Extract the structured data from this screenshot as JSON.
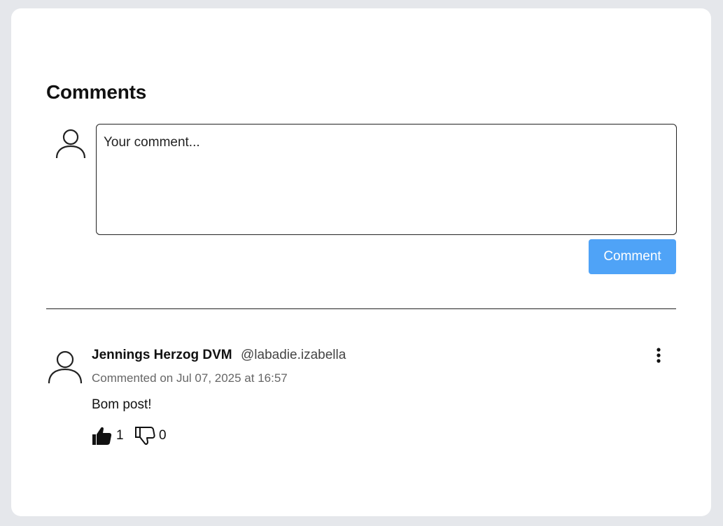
{
  "comments_section": {
    "title": "Comments",
    "composer": {
      "placeholder": "Your comment...",
      "value": "",
      "submit_label": "Comment",
      "submit_color": "#4fa3f7"
    },
    "comments": [
      {
        "author_name": "Jennings Herzog DVM",
        "author_handle": "@labadie.izabella",
        "timestamp": "Commented on Jul 07, 2025 at 16:57",
        "text": "Bom post!",
        "likes": "1",
        "dislikes": "0",
        "avatar_icon": "user-icon",
        "menu_icon": "more-vertical-icon",
        "like_icon": "thumbs-up-icon",
        "dislike_icon": "thumbs-down-icon"
      }
    ]
  }
}
